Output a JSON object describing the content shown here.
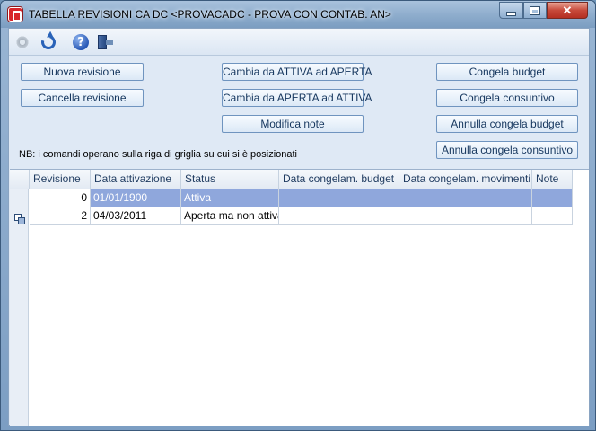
{
  "window": {
    "title": "TABELLA REVISIONI CA DC <PROVACADC - PROVA CON CONTAB. AN>",
    "controls": {
      "minimize": "minimize",
      "maximize": "maximize",
      "close": "✕"
    }
  },
  "toolbar": {
    "icons": [
      "gear-icon",
      "refresh-icon",
      "help-icon",
      "exit-icon"
    ]
  },
  "actions": {
    "nuova_revisione": "Nuova revisione",
    "cancella_revisione": "Cancella revisione",
    "cambia_attiva_aperta": "Cambia da ATTIVA ad APERTA",
    "cambia_aperta_attiva": "Cambia da APERTA ad ATTIVA",
    "modifica_note": "Modifica note",
    "congela_budget": "Congela budget",
    "congela_consuntivo": "Congela consuntivo",
    "annulla_congela_budget": "Annulla congela budget",
    "annulla_congela_consuntivo": "Annulla congela consuntivo"
  },
  "note": "NB: i comandi operano sulla riga di griglia su cui si è posizionati",
  "grid": {
    "columns": [
      "Revisione",
      "Data attivazione",
      "Status",
      "Data congelam. budget",
      "Data congelam. movimenti",
      "Note"
    ],
    "rows": [
      {
        "revisione": "0",
        "data_attivazione": "01/01/1900",
        "status": "Attiva",
        "data_congelam_budget": "",
        "data_congelam_movimenti": "",
        "note": ""
      },
      {
        "revisione": "2",
        "data_attivazione": "04/03/2011",
        "status": "Aperta ma non attiva",
        "data_congelam_budget": "",
        "data_congelam_movimenti": "",
        "note": ""
      }
    ],
    "selected_row": 0,
    "current_row": 1
  },
  "colors": {
    "selection": "#8fa7dc",
    "button_border": "#6f94bf",
    "client_bg": "#dfe9f5"
  }
}
